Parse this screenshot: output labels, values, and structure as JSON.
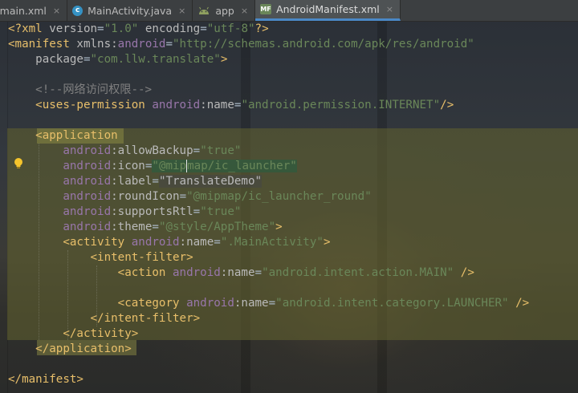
{
  "tabs": [
    {
      "label": "y_main.xml",
      "icon": "xml-layout-icon",
      "active": false
    },
    {
      "label": "MainActivity.java",
      "icon": "java-class-icon",
      "active": false
    },
    {
      "label": "app",
      "icon": "android-module-icon",
      "active": false
    },
    {
      "label": "AndroidManifest.xml",
      "icon": "manifest-file-icon",
      "active": true
    }
  ],
  "tab_close_glyph": "×",
  "code": {
    "l1": {
      "a": "<?xml ",
      "b": "version",
      "c": "=",
      "d": "\"1.0\"",
      "e": " ",
      "f": "encoding",
      "g": "=",
      "h": "\"utf-8\"",
      "i": "?>"
    },
    "l2": {
      "a": "<manifest ",
      "b": "xmlns:",
      "c": "android",
      "d": "=",
      "e": "\"http://schemas.android.com/apk/res/android\""
    },
    "l3": {
      "a": "    package",
      "b": "=",
      "c": "\"com.llw.translate\"",
      "d": ">"
    },
    "l5": {
      "a": "    <!--网络访问权限-->"
    },
    "l6": {
      "a": "    <uses-permission ",
      "b": "android",
      "c": ":name",
      "d": "=",
      "e": "\"android.permission.INTERNET\"",
      "f": "/>"
    },
    "l8": {
      "a": "    <application"
    },
    "l9": {
      "a": "        ",
      "b": "android",
      "c": ":allowBackup",
      "d": "=",
      "e": "\"true\""
    },
    "l10": {
      "a": "        ",
      "b": "android",
      "c": ":icon",
      "d": "=",
      "e": "\"@mip",
      "f": "map/ic_launcher\""
    },
    "l11": {
      "a": "        ",
      "b": "android",
      "c": ":label",
      "d": "=",
      "e": "\"TranslateDemo\""
    },
    "l12": {
      "a": "        ",
      "b": "android",
      "c": ":roundIcon",
      "d": "=",
      "e": "\"@mipmap/ic_launcher_round\""
    },
    "l13": {
      "a": "        ",
      "b": "android",
      "c": ":supportsRtl",
      "d": "=",
      "e": "\"true\""
    },
    "l14": {
      "a": "        ",
      "b": "android",
      "c": ":theme",
      "d": "=",
      "e": "\"@style/AppTheme\"",
      "f": ">"
    },
    "l15": {
      "a": "        <activity ",
      "b": "android",
      "c": ":name",
      "d": "=",
      "e": "\".MainActivity\"",
      "f": ">"
    },
    "l16": {
      "a": "            <intent-filter>"
    },
    "l17": {
      "a": "                <action ",
      "b": "android",
      "c": ":name",
      "d": "=",
      "e": "\"android.intent.action.MAIN\"",
      "f": " />"
    },
    "l19": {
      "a": "                <category ",
      "b": "android",
      "c": ":name",
      "d": "=",
      "e": "\"android.intent.category.LAUNCHER\"",
      "f": " />"
    },
    "l20": {
      "a": "            </intent-filter>"
    },
    "l21": {
      "a": "        </activity>"
    },
    "l22": {
      "a": "    </application>"
    },
    "l24": {
      "a": "</manifest>"
    }
  }
}
